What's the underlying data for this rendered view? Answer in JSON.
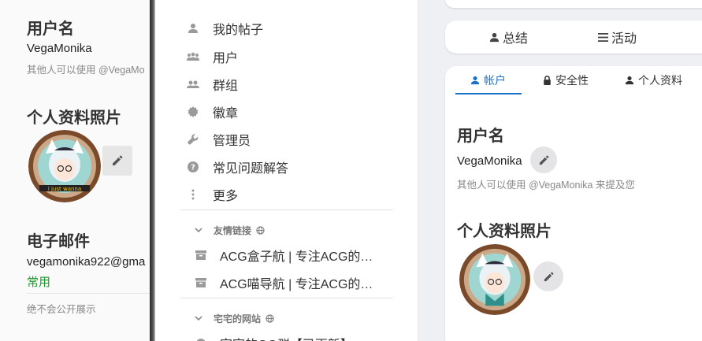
{
  "left_panel": {
    "username_heading": "用户名",
    "username_value": "VegaMonika",
    "username_hint": "其他人可以使用 @VegaMo",
    "photo_heading": "个人资料照片",
    "avatar_banner": "i just wanna",
    "email_heading": "电子邮件",
    "email_value": "vegamonika922@gma",
    "email_status": "常用",
    "email_hint": "绝不会公开展示"
  },
  "menu": {
    "items": [
      {
        "label": "我的帖子",
        "icon": "user-icon"
      },
      {
        "label": "用户",
        "icon": "users-icon"
      },
      {
        "label": "群组",
        "icon": "group-icon"
      },
      {
        "label": "徽章",
        "icon": "badge-icon"
      },
      {
        "label": "管理员",
        "icon": "wrench-icon"
      },
      {
        "label": "常见问题解答",
        "icon": "question-icon"
      },
      {
        "label": "更多",
        "icon": "more-vertical-icon"
      }
    ],
    "section_friend_links": "友情链接",
    "friend_links": [
      {
        "label": "ACG盒子航 | 专注ACG的…",
        "icon": "archive-icon"
      },
      {
        "label": "ACG喵导航 | 专注ACG的…",
        "icon": "archive-icon"
      }
    ],
    "section_site": "宅宅的网站",
    "site_partial_label": "宅宅的QQ群【已更新】"
  },
  "right": {
    "tabsbar": {
      "summary": "总结",
      "activity": "活动"
    },
    "profile_tabs": {
      "account": "帐户",
      "security": "安全性",
      "profile": "个人资料"
    },
    "username_heading": "用户名",
    "username_value": "VegaMonika",
    "username_hint": "其他人可以使用 @VegaMonika 来提及您",
    "photo_heading": "个人资料照片"
  },
  "colors": {
    "accent": "#1a73c9",
    "status_green": "#1a9a2a"
  }
}
